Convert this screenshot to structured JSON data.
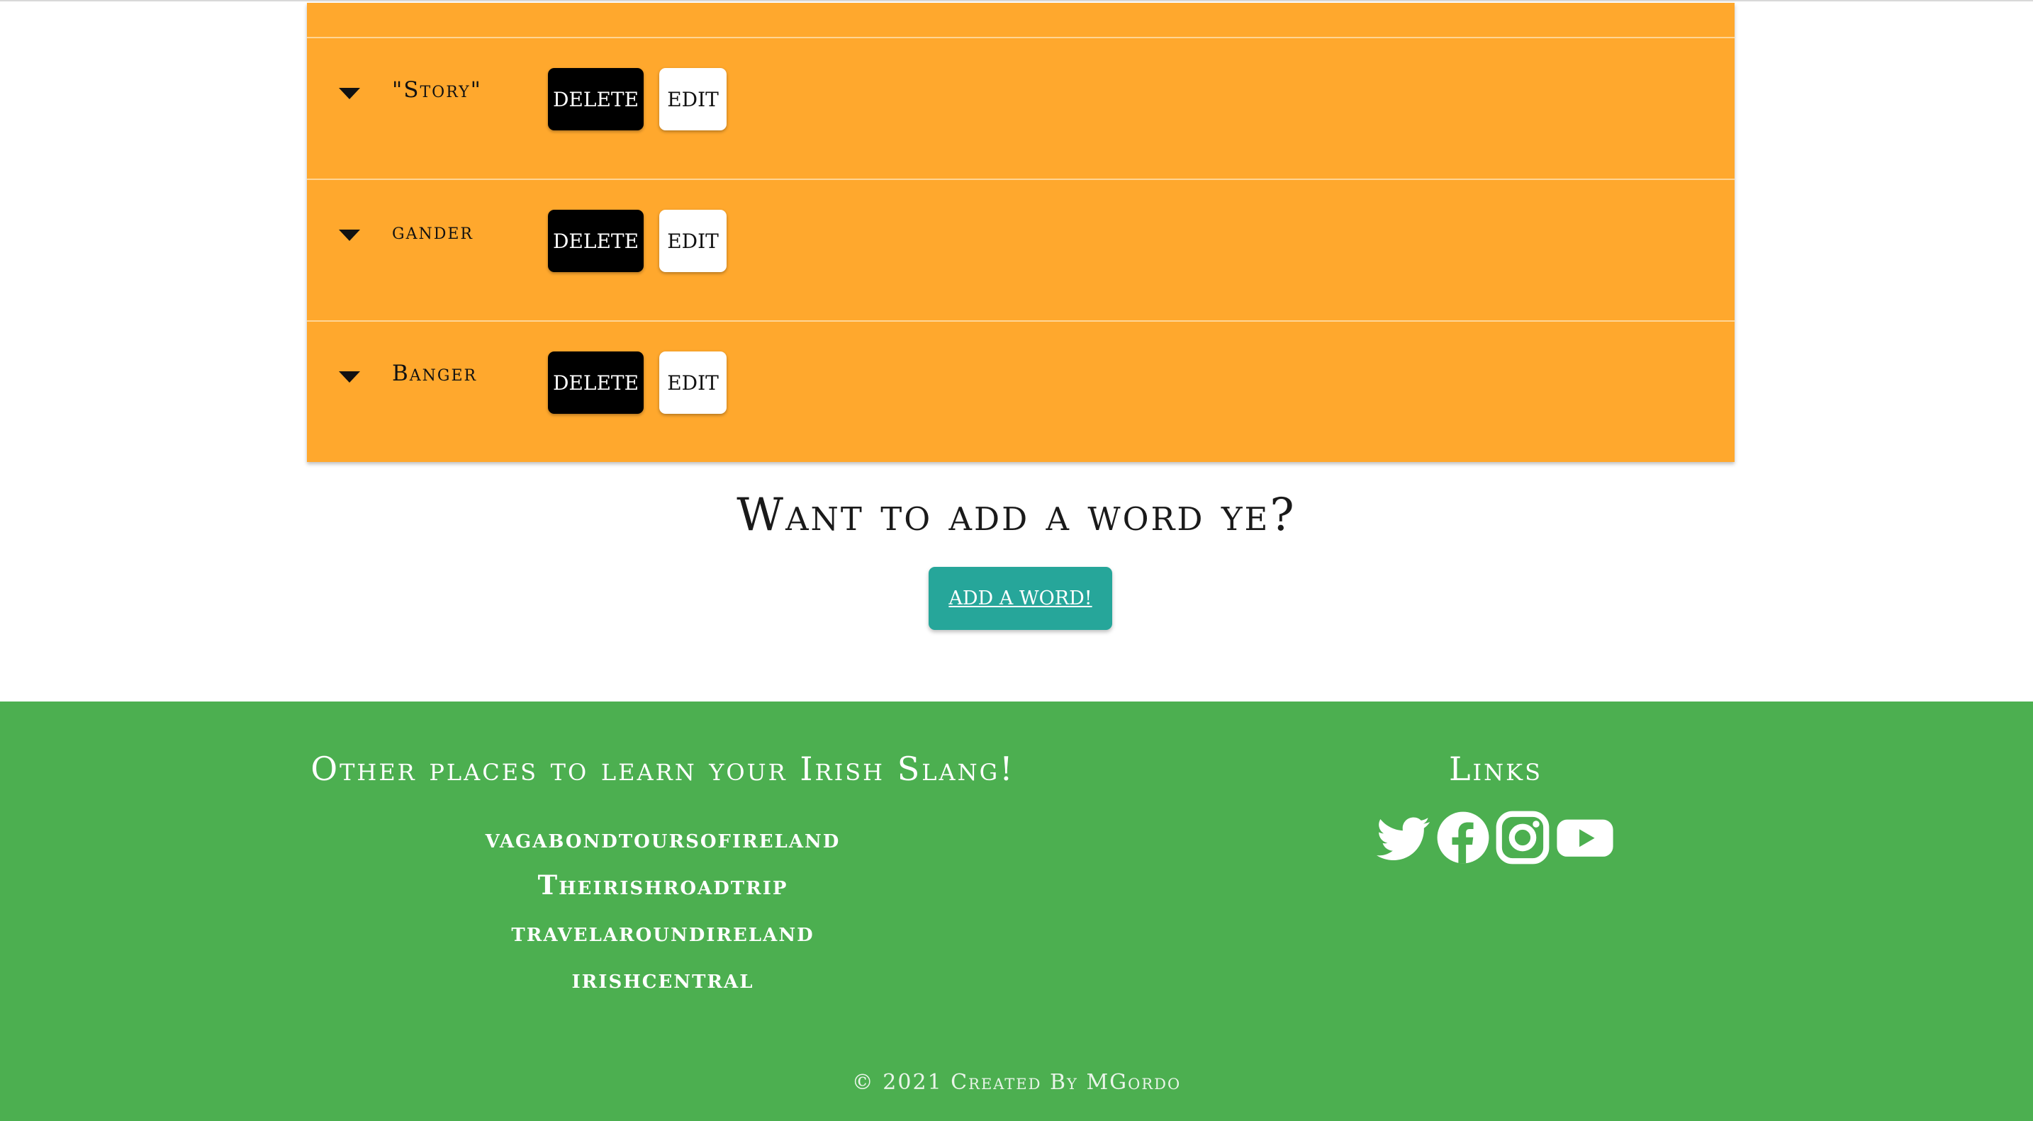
{
  "words": [
    {
      "label": "\"Story\"",
      "delete_label": "DELETE",
      "edit_label": "EDIT"
    },
    {
      "label": "gander",
      "delete_label": "DELETE",
      "edit_label": "EDIT"
    },
    {
      "label": "Banger",
      "delete_label": "DELETE",
      "edit_label": "EDIT"
    }
  ],
  "add_section": {
    "heading": "Want to add a word ye?",
    "button_label": "ADD A WORD!"
  },
  "footer": {
    "places_heading": "Other places to learn your Irish Slang!",
    "places": [
      "vagabondtoursofireland",
      "Theirishroadtrip",
      "travelaroundireland",
      "irishcentral"
    ],
    "links_heading": "Links",
    "social_icons": [
      "twitter-icon",
      "facebook-icon",
      "instagram-icon",
      "youtube-icon"
    ],
    "copyright": "© 2021 Created By MGordo"
  },
  "colors": {
    "list_background": "#ffa82d",
    "delete_button": "#000000",
    "edit_button": "#ffffff",
    "add_button": "#26a69a",
    "footer_background": "#4caf50"
  }
}
